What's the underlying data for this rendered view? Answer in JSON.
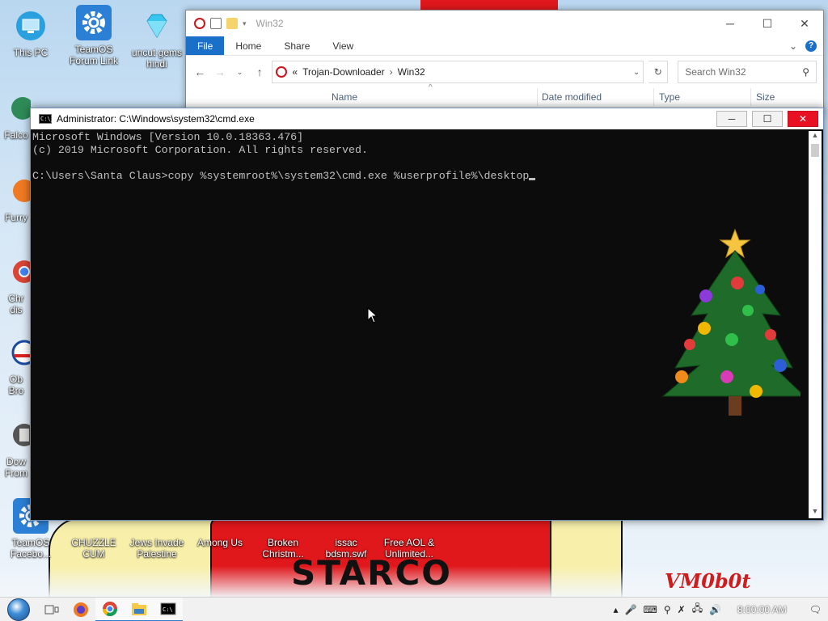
{
  "desktop": {
    "icons": [
      {
        "label": "This PC"
      },
      {
        "label": "TeamOS Forum Link"
      },
      {
        "label": "uncut gems hindi"
      },
      {
        "label": "Falco"
      },
      {
        "label": "Furry"
      },
      {
        "label": "Chr dis"
      },
      {
        "label": "Ob Bro"
      },
      {
        "label": "Dow From"
      },
      {
        "label": "TeamOS Facebo..."
      },
      {
        "label": "CHUZZLE CUM"
      },
      {
        "label": "Jews Invade Palestine"
      },
      {
        "label": "Among Us"
      },
      {
        "label": "Broken Christm..."
      },
      {
        "label": "issac bdsm.swf"
      },
      {
        "label": "Free AOL & Unlimited..."
      }
    ],
    "wallpaper_text": "STARCO",
    "signature": "VM0b0t"
  },
  "explorer": {
    "title": "Win32",
    "tabs": [
      "File",
      "Home",
      "Share",
      "View"
    ],
    "breadcrumb": {
      "prefix": "«",
      "parent": "Trojan-Downloader",
      "separator": "›",
      "current": "Win32"
    },
    "search_placeholder": "Search Win32",
    "columns": [
      "Name",
      "Date modified",
      "Type",
      "Size"
    ],
    "help_label": "?"
  },
  "cmd": {
    "title": "Administrator: C:\\Windows\\system32\\cmd.exe",
    "lines": [
      "Microsoft Windows [Version 10.0.18363.476]",
      "(c) 2019 Microsoft Corporation. All rights reserved.",
      "",
      "C:\\Users\\Santa Claus>copy %systemroot%\\system32\\cmd.exe %userprofile%\\desktop"
    ]
  },
  "taskbar": {
    "clock": "8:00:00 AM",
    "pinned": [
      "task-view-icon",
      "firefox-icon",
      "chrome-icon",
      "file-explorer-icon",
      "cmd-icon"
    ]
  },
  "colors": {
    "accent": "#1a6fc9",
    "close_red": "#e81123",
    "console_bg": "#0c0c0c",
    "console_fg": "#c0c0c0"
  }
}
